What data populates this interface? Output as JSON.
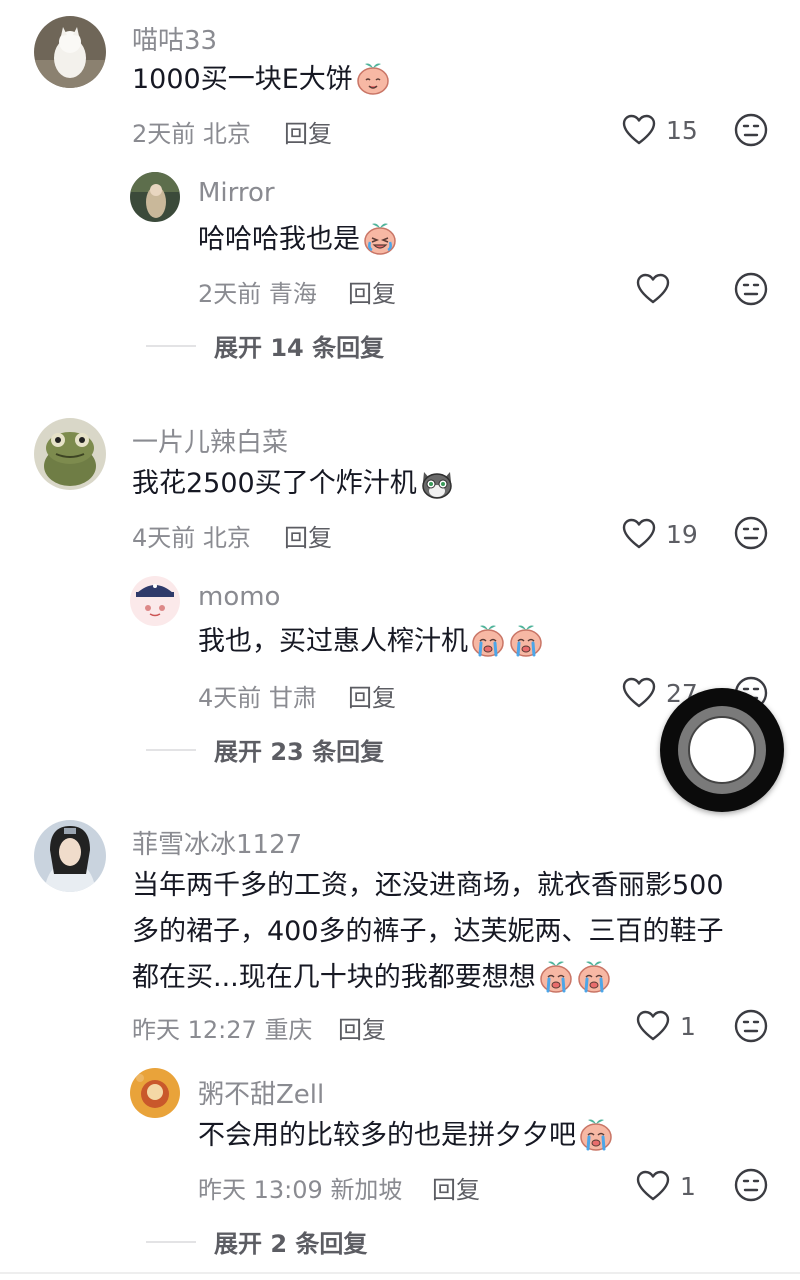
{
  "comments": [
    {
      "username": "喵咕33",
      "text": "1000买一块E大饼",
      "emoji": "smile-blush-emoji",
      "time": "2天前",
      "location": "北京",
      "reply_label": "回复",
      "likes": "15",
      "reply": {
        "username": "Mirror",
        "text": "哈哈哈我也是",
        "emoji": "laugh-cry-emoji",
        "time": "2天前",
        "location": "青海",
        "reply_label": "回复",
        "likes": ""
      },
      "expand_label": "展开 14 条回复"
    },
    {
      "username": "一片儿辣白菜",
      "text": "我花2500买了个炸汁机",
      "emoji": "cat-face-emoji",
      "time": "4天前",
      "location": "北京",
      "reply_label": "回复",
      "likes": "19",
      "reply": {
        "username": "momo",
        "text": "我也，买过惠人榨汁机",
        "emoji": "cry-emoji",
        "time": "4天前",
        "location": "甘肃",
        "reply_label": "回复",
        "likes": "27"
      },
      "expand_label": "展开 23 条回复"
    },
    {
      "username": "菲雪冰冰1127",
      "text_lines": [
        "当年两千多的工资，还没进商场，就衣香丽影500",
        "多的裙子，400多的裤子，达芙妮两、三百的鞋子",
        "都在买...现在几十块的我都要想想"
      ],
      "emoji": "cry-emoji",
      "time": "昨天 12:27",
      "location": "重庆",
      "reply_label": "回复",
      "likes": "1",
      "reply": {
        "username": "粥不甜Zell",
        "text": "不会用的比较多的也是拼夕夕吧",
        "emoji": "cry-emoji",
        "time": "昨天 13:09",
        "location": "新加坡",
        "reply_label": "回复",
        "likes": "1"
      },
      "expand_label": "展开 2 条回复"
    }
  ],
  "icons": {
    "like": "heart-outline-icon",
    "dislike": "neutral-face-icon",
    "scroll": "floating-scroll-button"
  },
  "colors": {
    "username": "#8a8b91",
    "text": "#161823",
    "meta": "#8a8b91",
    "emoji_face": "#f7b8a4",
    "emoji_leaf": "#4fb39a"
  }
}
